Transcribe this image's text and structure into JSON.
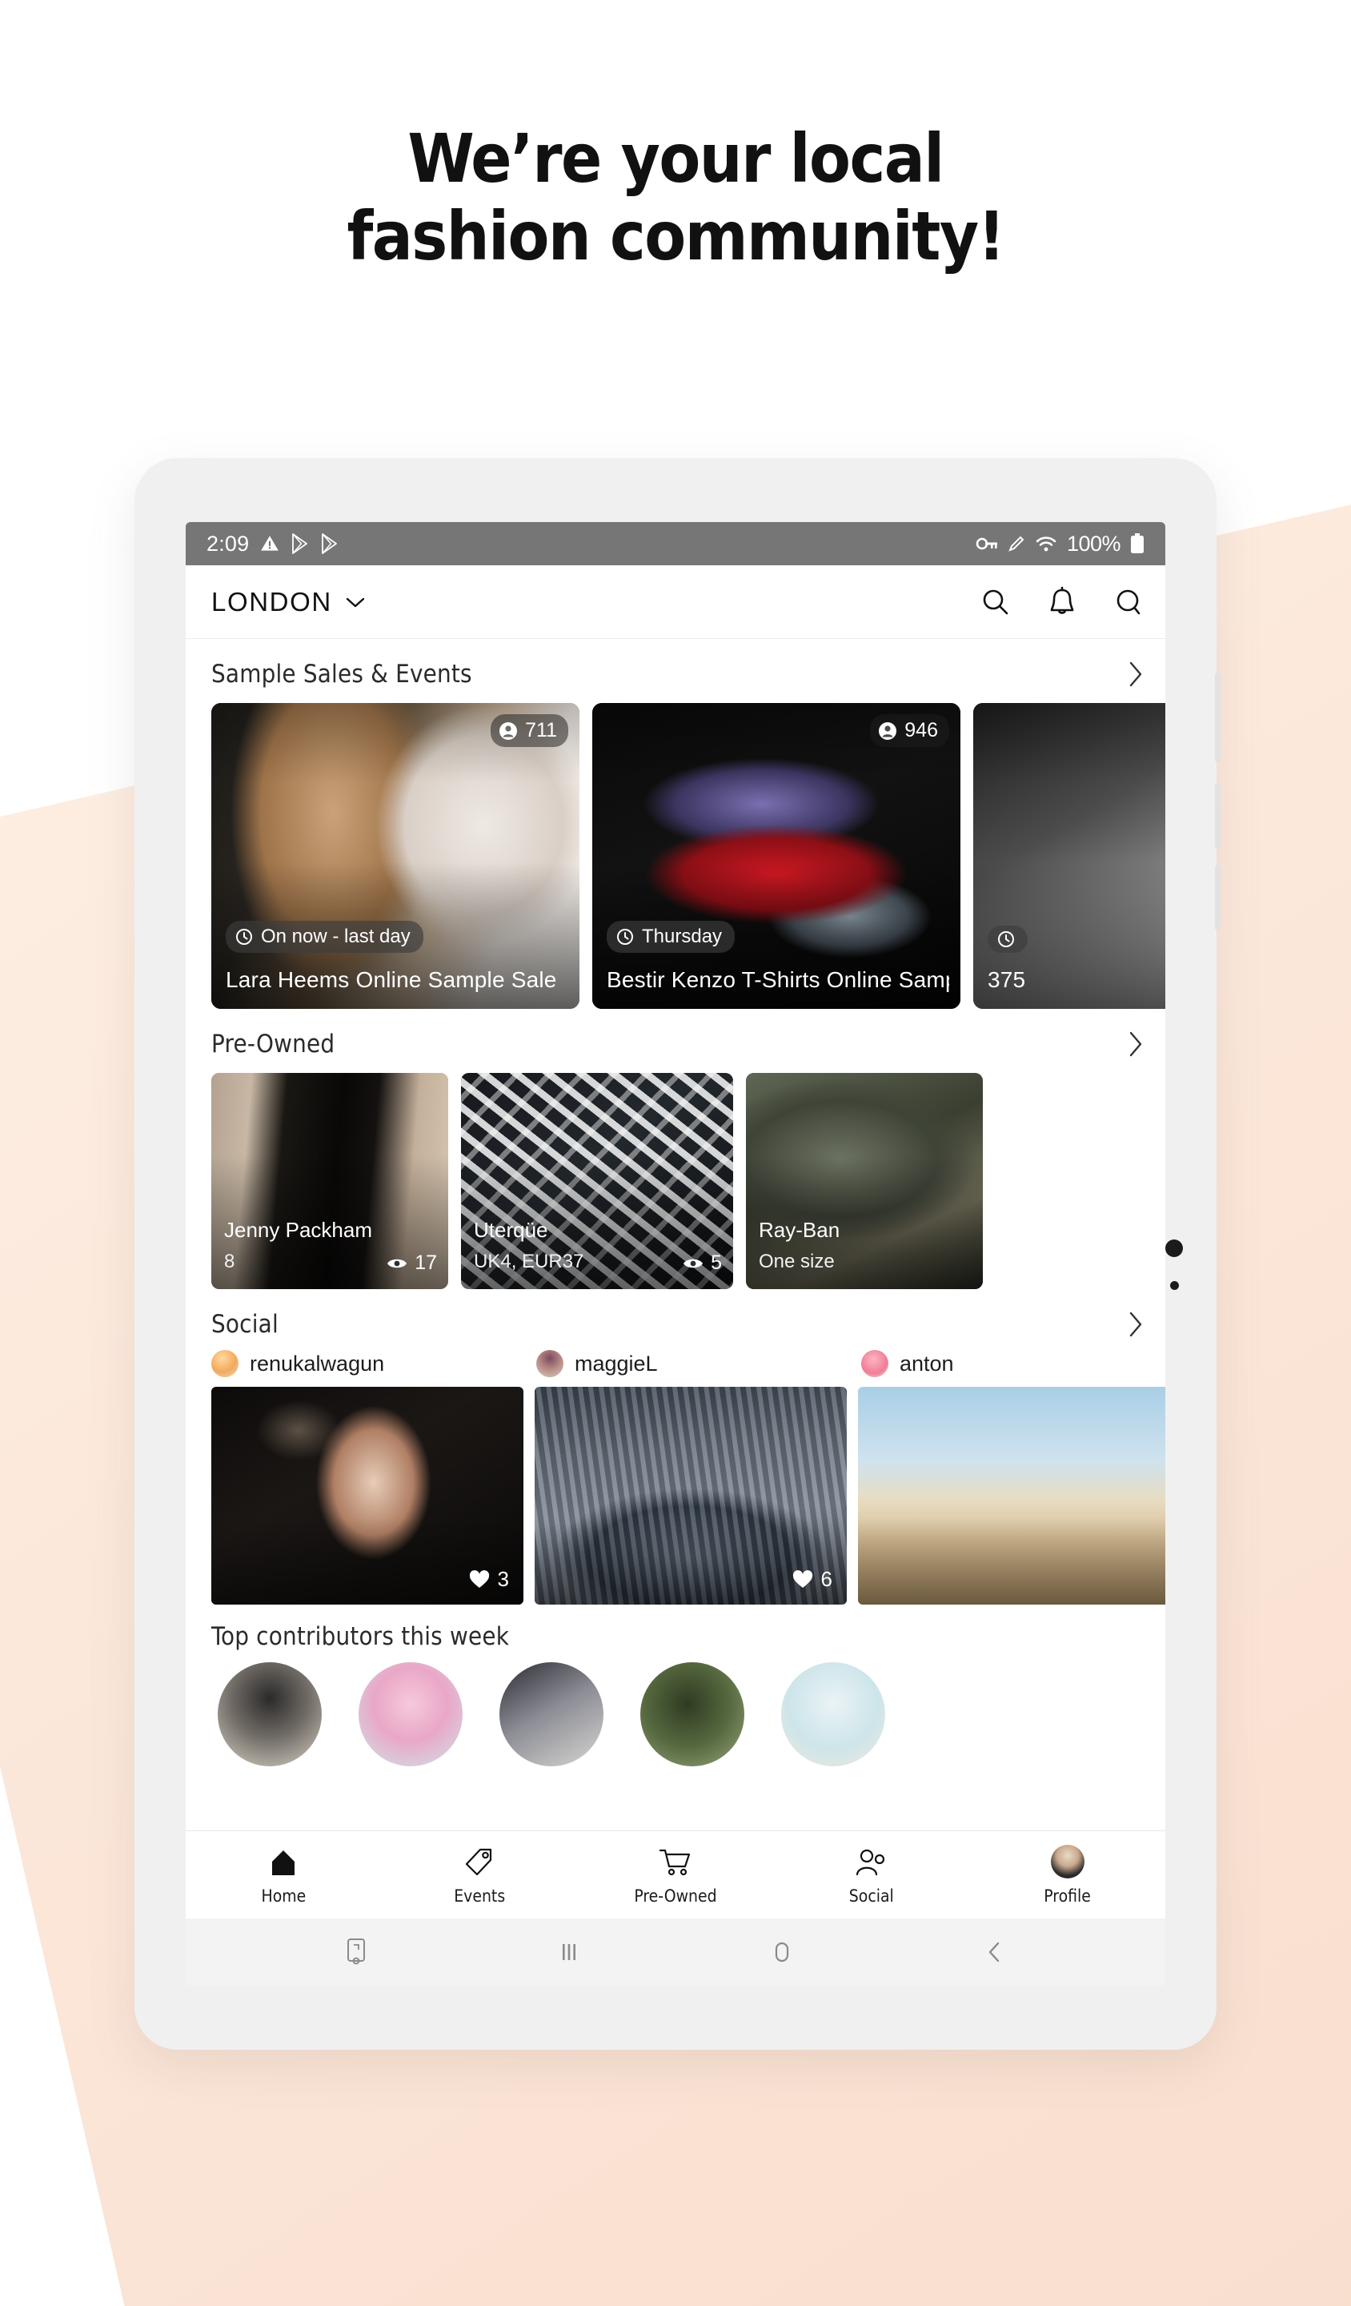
{
  "hero": {
    "line1": "We’re your local",
    "line2": "fashion community!"
  },
  "status_bar": {
    "time": "2:09",
    "battery_percent": "100%",
    "icons": [
      "warning-triangle-icon",
      "play-store-icon",
      "play-store-icon",
      "key-icon",
      "pencil-icon",
      "wifi-icon",
      "battery-icon"
    ]
  },
  "app_header": {
    "city": "LONDON",
    "chevron": "chevron-down-icon",
    "actions": [
      "search-icon",
      "bell-icon",
      "chat-bubble-icon"
    ]
  },
  "sections": {
    "events": {
      "title": "Sample Sales & Events",
      "arrow": "chevron-right-icon",
      "cards": [
        {
          "attendees": "711",
          "when": "On now - last day",
          "title": "Lara Heems Online Sample Sale"
        },
        {
          "attendees": "946",
          "when": "Thursday",
          "title": "Bestir Kenzo T-Shirts Online Sample Sale"
        },
        {
          "attendees": "",
          "when": "",
          "title": "375"
        }
      ]
    },
    "preowned": {
      "title": "Pre-Owned",
      "arrow": "chevron-right-icon",
      "cards": [
        {
          "brand": "Jenny Packham",
          "size": "8",
          "views": "17"
        },
        {
          "brand": "Uterqüe",
          "size": "UK4, EUR37",
          "views": "5"
        },
        {
          "brand": "Ray-Ban",
          "size": "One size",
          "views": ""
        }
      ]
    },
    "social": {
      "title": "Social",
      "arrow": "chevron-right-icon",
      "users": [
        {
          "name": "renukalwagun"
        },
        {
          "name": "maggieL"
        },
        {
          "name": "anton"
        }
      ],
      "posts": [
        {
          "likes": "3"
        },
        {
          "likes": "6"
        },
        {
          "likes": ""
        }
      ]
    },
    "contributors": {
      "title": "Top contributors this week"
    }
  },
  "tabbar": {
    "items": [
      {
        "label": "Home",
        "icon": "home-icon",
        "active": true
      },
      {
        "label": "Events",
        "icon": "tag-icon",
        "active": false
      },
      {
        "label": "Pre-Owned",
        "icon": "shopping-cart-icon",
        "active": false
      },
      {
        "label": "Social",
        "icon": "people-icon",
        "active": false
      },
      {
        "label": "Profile",
        "icon": "avatar-icon",
        "active": false
      }
    ]
  },
  "android_navbar": {
    "buttons": [
      "screenshot-icon",
      "recents-icon",
      "home-icon",
      "back-icon"
    ]
  },
  "colors": {
    "page_background": "#ffffff",
    "peach_accent": "#fbe6d8",
    "status_bar": "#767676",
    "text_primary": "#111111"
  }
}
